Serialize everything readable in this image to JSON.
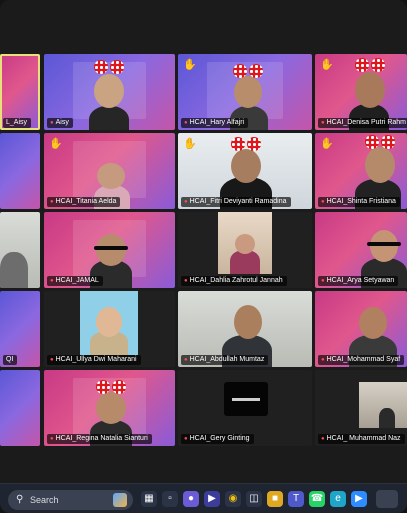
{
  "meeting": {
    "participants": [
      {
        "name": "L_Aisy"
      },
      {
        "name": "HCAI_Hary Alfajri"
      },
      {
        "name": "HCAI_Denisa Putri Rahm"
      },
      {
        "name": "HCAI_Titania Aelda"
      },
      {
        "name": "HCAI_Fitri Deviyanti Ramadina"
      },
      {
        "name": "HCAI_Shinta Fristiana"
      },
      {
        "name": "HCAI_JAMAL"
      },
      {
        "name": "HCAI_Dahlia Zahrotul Jannah"
      },
      {
        "name": "HCAI_Arya Setyawan"
      },
      {
        "name": "HCAI_Ullya Dwi Maharani"
      },
      {
        "name": "HCAI_Abdullah Mumtaz"
      },
      {
        "name": "HCAI_Mohammad Syaf"
      },
      {
        "name": "HCAI_Regina Natalia Sianturi"
      },
      {
        "name": "HCAI_Gery Ginting"
      },
      {
        "name": "HCAI_ Muhammad Naz"
      },
      {
        "name": "QI"
      }
    ],
    "hand_icon": "raised-hand-icon",
    "mic_icon": "muted-mic-icon"
  },
  "taskbar": {
    "search_placeholder": "Search",
    "search_icon": "search-icon",
    "icons": [
      "windows-start-icon",
      "task-view-icon",
      "chat-icon",
      "media-icon",
      "chrome-icon",
      "store-icon",
      "file-explorer-icon",
      "teams-icon",
      "whatsapp-icon",
      "edge-icon",
      "zoom-icon"
    ]
  },
  "colors": {
    "accent": "#e8e07a",
    "taskbar": "#1e2430",
    "muted": "#ff4d4d"
  }
}
